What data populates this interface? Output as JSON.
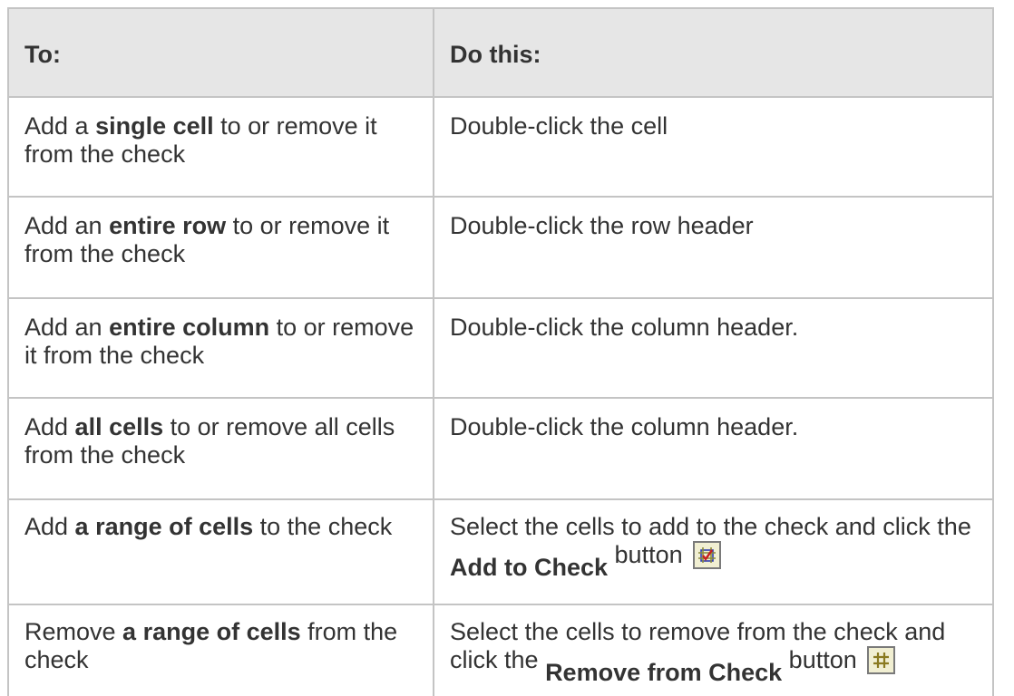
{
  "table": {
    "headers": [
      "To:",
      "Do this:"
    ],
    "rows": [
      {
        "to_pre": "Add a ",
        "to_bold": "single cell",
        "to_post": " to or remove it from the check",
        "do": "Double-click the cell"
      },
      {
        "to_pre": "Add an ",
        "to_bold": "entire row",
        "to_post": " to or remove it from the check",
        "do": "Double-click the row header"
      },
      {
        "to_pre": "Add an ",
        "to_bold": "entire column",
        "to_post": " to or remove it from the check",
        "do": "Double-click the column header."
      },
      {
        "to_pre": "Add ",
        "to_bold": "all cells",
        "to_post": " to or remove all cells from the check",
        "do": "Double-click the column header."
      },
      {
        "to_pre": "Add ",
        "to_bold": "a range of cells",
        "to_post": " to the check",
        "do_pre": "Select the cells to add to the check and click the",
        "do_button": "Add to Check",
        "do_post": "button",
        "icon": "add-to-check-icon"
      },
      {
        "to_pre": "Remove ",
        "to_bold": "a range of cells",
        "to_post": " from the check",
        "do_pre": "Select the cells to remove from the check and click the",
        "do_button": "Remove from Check",
        "do_post": "button",
        "icon": "remove-from-check-icon"
      }
    ]
  },
  "colors": {
    "header_background": "#e6e6e6",
    "border": "#c4c4c4",
    "text": "#333333",
    "icon_background": "#f1efd2"
  }
}
